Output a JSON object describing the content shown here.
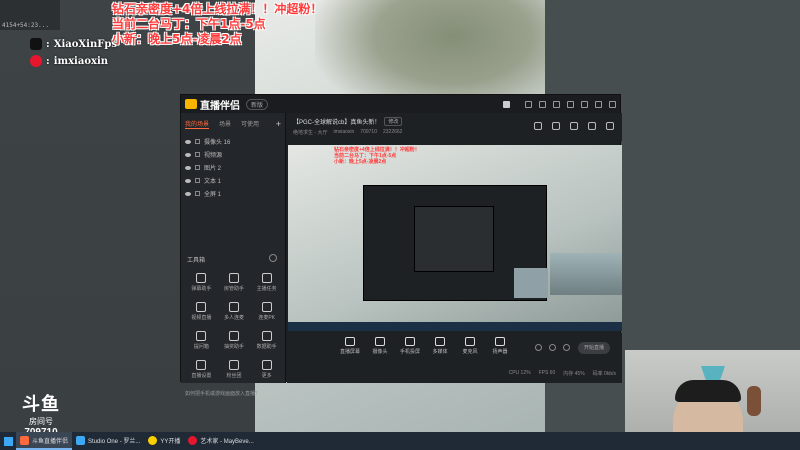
{
  "overlay": {
    "top_left_text": "4154+54:23...",
    "promo_lines": [
      "钻石亲密度+4倍上线拉满！！冲超粉！",
      "当前二台马丁：下午1点-5点",
      "小新：晚上5点-凌晨2点"
    ],
    "douyin": "XiaoXinFps",
    "weibo": "imxiaoxin",
    "logo": {
      "brand": "斗鱼",
      "sub": "房间号",
      "room": "709710"
    }
  },
  "app": {
    "title": "直播伴侣",
    "version": "新版",
    "tabs": [
      "我的场景",
      "场景",
      "可使用"
    ],
    "scenes": [
      {
        "label": "摄像头 16"
      },
      {
        "label": "视频源"
      },
      {
        "label": "图片 2"
      },
      {
        "label": "文本 1"
      },
      {
        "label": "全屏 1"
      }
    ],
    "tools_title": "工具箱",
    "tools": [
      "弹幕助手",
      "房管助手",
      "主播任务",
      "视频直播",
      "多人连麦",
      "连麦PK",
      "提问箱",
      "抽奖助手",
      "数据助手",
      "直播设置",
      "粉丝团",
      "更多"
    ],
    "bottom_tip": "如何把手机或游戏画面放入直播？",
    "stream_title": "【PGC-全球解说cb】真鱼头新！",
    "edit_label": "修改",
    "meta": [
      "绝地求生 - 大厅",
      "imxiaoxin",
      "709710",
      "2322662"
    ],
    "preview_promo": [
      "钻石亲密度+4倍上线拉满！！冲超粉！",
      "当前二台马丁：下午1点-5点",
      "小新：晚上5点-凌晨2点"
    ],
    "controls": [
      "直播屏幕",
      "摄像头",
      "手机投屏",
      "多媒体",
      "麦克风",
      "扬声器"
    ],
    "start_label": "开始直播",
    "stats": [
      "CPU 12%",
      "FPS 60",
      "内存 45%",
      "码率 0kb/s"
    ]
  },
  "taskbar": {
    "items": [
      {
        "label": "斗鱼直播伴侣",
        "active": true,
        "color": "#ff6a3d"
      },
      {
        "label": "Studio One - 罗兰...",
        "active": false,
        "color": "#3da9f5"
      },
      {
        "label": "YY开播",
        "active": false,
        "color": "#f7d000"
      },
      {
        "label": "艺术家 - MayBeve...",
        "active": false,
        "color": "#e6162d"
      }
    ]
  }
}
